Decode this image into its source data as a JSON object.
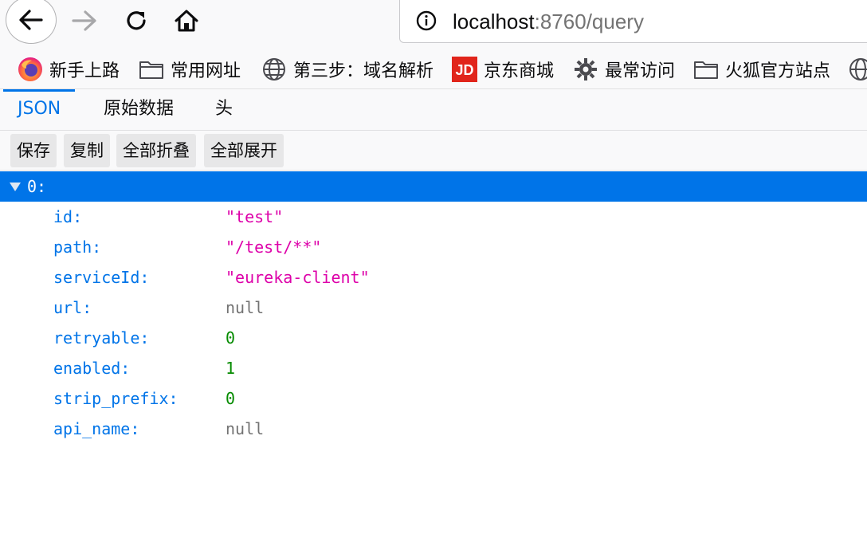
{
  "navigation": {
    "url_host": "localhost",
    "url_rest": ":8760/query"
  },
  "bookmarks": [
    {
      "label": "新手上路",
      "icon": "firefox-icon"
    },
    {
      "label": "常用网址",
      "icon": "folder-icon"
    },
    {
      "label": "第三步：域名解析",
      "icon": "globe-icon"
    },
    {
      "label": "京东商城",
      "icon": "jd-icon"
    },
    {
      "label": "最常访问",
      "icon": "gear-icon"
    },
    {
      "label": "火狐官方站点",
      "icon": "folder-icon"
    }
  ],
  "jd_logo_text": "JD",
  "tabs": [
    {
      "label": "JSON",
      "active": true
    },
    {
      "label": "原始数据",
      "active": false
    },
    {
      "label": "头",
      "active": false
    }
  ],
  "toolbar": {
    "save_label": "保存",
    "copy_label": "复制",
    "collapse_all_label": "全部折叠",
    "expand_all_label": "全部展开"
  },
  "json_tree": {
    "root_key": "0:",
    "rows": [
      {
        "key": "id:",
        "value": "\"test\"",
        "type": "string"
      },
      {
        "key": "path:",
        "value": "\"/test/**\"",
        "type": "string"
      },
      {
        "key": "serviceId:",
        "value": "\"eureka-client\"",
        "type": "string"
      },
      {
        "key": "url:",
        "value": "null",
        "type": "null"
      },
      {
        "key": "retryable:",
        "value": "0",
        "type": "number"
      },
      {
        "key": "enabled:",
        "value": "1",
        "type": "number"
      },
      {
        "key": "strip_prefix:",
        "value": "0",
        "type": "number"
      },
      {
        "key": "api_name:",
        "value": "null",
        "type": "null"
      }
    ]
  },
  "colors": {
    "accent": "#0074e8",
    "string_value": "#dd00a9",
    "number_value": "#058b00",
    "null_value": "#737373"
  }
}
